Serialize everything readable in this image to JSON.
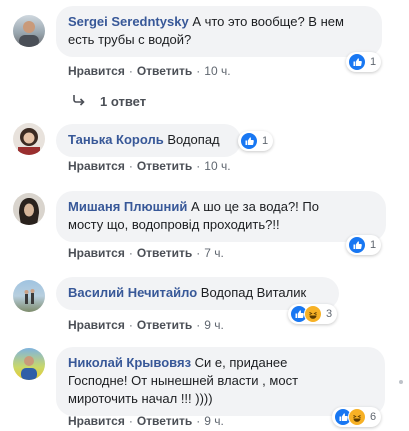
{
  "comments": [
    {
      "author": "Sergei Seredntysky",
      "text_line1": "А что это вообще? В нем",
      "text_line2": "есть трубы с водой?",
      "like": "Нравится",
      "reply": "Ответить",
      "time": "10 ч.",
      "reaction_count": "1",
      "replies_label": "1 ответ"
    },
    {
      "author": "Танька Король",
      "text_line1": "Водопад",
      "like": "Нравится",
      "reply": "Ответить",
      "time": "10 ч.",
      "reaction_count": "1"
    },
    {
      "author": "Мишаня Плюшний",
      "text_line1": "А шо це за вода?! По",
      "text_line2": "мосту що, водопровід проходить?!!",
      "like": "Нравится",
      "reply": "Ответить",
      "time": "7 ч.",
      "reaction_count": "1"
    },
    {
      "author": "Василий Нечитайло",
      "text_line1": "Водопад Виталик",
      "like": "Нравится",
      "reply": "Ответить",
      "time": "9 ч.",
      "reaction_count": "3"
    },
    {
      "author": "Николай Крывовяз",
      "text_line1": "Си е, приданее",
      "text_line2": "Господне! От нынешней власти , мост",
      "text_line3": "мироточить начал !!! ))))",
      "like": "Нравится",
      "reply": "Ответить",
      "time": "9 ч.",
      "reaction_count": "6"
    }
  ],
  "separator": "·",
  "colors": {
    "bubble": "#f2f3f5",
    "author": "#385898",
    "like_blue": "#1877f2",
    "haha_yellow": "#f7b125"
  },
  "icons": [
    "like-reaction-icon",
    "haha-reaction-icon",
    "reply-arrow-icon",
    "avatar"
  ]
}
